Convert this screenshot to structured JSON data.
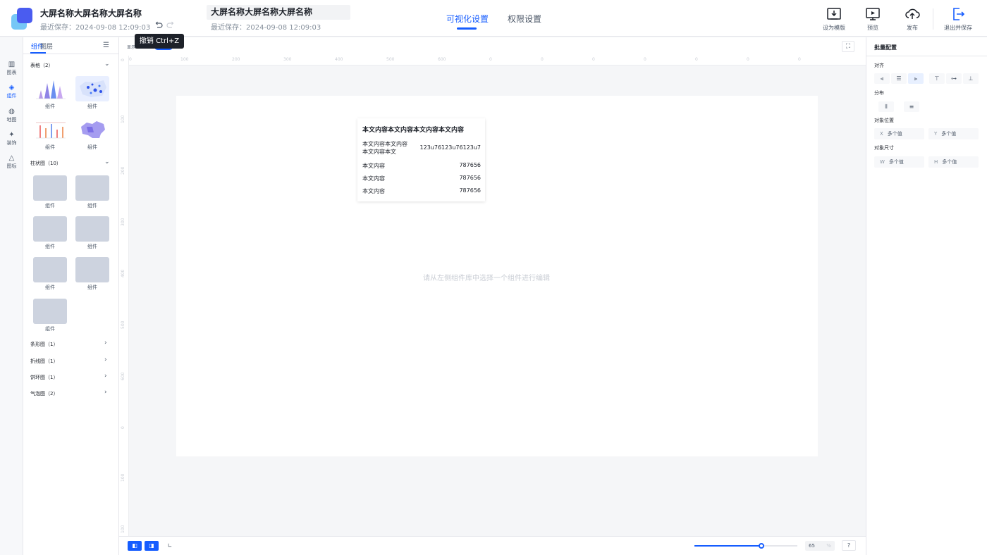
{
  "header": {
    "project_title": "大屏名称大屏名称大屏名称",
    "last_saved": "最近保存：2024-09-08 12:09:03",
    "screen_title": "大屏名称大屏名称大屏名称",
    "screen_last_saved": "最近保存：2024-09-08 12:09:03",
    "undo_tooltip": "撤销 Ctrl+Z",
    "tabs": [
      {
        "label": "可视化设置",
        "active": true
      },
      {
        "label": "权限设置",
        "active": false
      }
    ],
    "actions": [
      {
        "label": "设为模版",
        "icon": "download-tray-icon"
      },
      {
        "label": "预览",
        "icon": "monitor-play-icon"
      },
      {
        "label": "发布",
        "icon": "cloud-upload-icon"
      },
      {
        "label": "退出并保存",
        "icon": "exit-save-icon"
      }
    ],
    "accent_color": "#165dff"
  },
  "iconbar": {
    "items": [
      {
        "label": "图表",
        "icon": "chart-icon"
      },
      {
        "label": "组件",
        "icon": "layers-icon",
        "active": true
      },
      {
        "label": "地图",
        "icon": "globe-icon"
      },
      {
        "label": "装饰",
        "icon": "sparkle-icon"
      },
      {
        "label": "图标",
        "icon": "shapes-icon"
      }
    ]
  },
  "left_panel": {
    "tabs": [
      {
        "label": "组件",
        "active": true
      },
      {
        "label": "图层",
        "active": false
      }
    ],
    "groups": [
      {
        "title": "表格（2）",
        "expanded": true
      },
      {
        "title": "柱状图（10）",
        "expanded": true
      },
      {
        "title": "条形图（1）",
        "expanded": false
      },
      {
        "title": "折线图（1）",
        "expanded": false
      },
      {
        "title": "饼环图（1）",
        "expanded": false
      },
      {
        "title": "气泡图（2）",
        "expanded": false
      }
    ],
    "item_label": "组件"
  },
  "canvas": {
    "header_label": "显示",
    "ruler_top": [
      "0",
      "100",
      "200",
      "300",
      "400",
      "500",
      "600",
      "0",
      "0",
      "0",
      "0",
      "0",
      "0",
      "0"
    ],
    "ruler_left": [
      "0",
      "100",
      "200",
      "300",
      "400",
      "500",
      "600",
      "0",
      "100",
      "100"
    ],
    "placeholder": "请从左侧组件库中选择一个组件进行编辑",
    "card": {
      "title": "本文内容本文内容本文内容本文内容",
      "rows": [
        {
          "label_line1": "本文内容本文内容",
          "label_line2": "本文内容本文",
          "value": "123u76123u76123u7"
        },
        {
          "label_line1": "本文内容",
          "value": "787656"
        },
        {
          "label_line1": "本文内容",
          "value": "787656"
        },
        {
          "label_line1": "本文内容",
          "value": "787656"
        }
      ]
    }
  },
  "bottom": {
    "zoom": "65",
    "zoom_unit": "%",
    "zoom_fraction": 0.65
  },
  "right_panel": {
    "title": "批量配置",
    "align_label": "对齐",
    "distribute_label": "分布",
    "position_label": "对象位置",
    "size_label": "对象尺寸",
    "x_key": "X",
    "x_value": "多个值",
    "y_key": "Y",
    "y_value": "多个值",
    "w_key": "W",
    "w_value": "多个值",
    "h_key": "H",
    "h_value": "多个值"
  }
}
